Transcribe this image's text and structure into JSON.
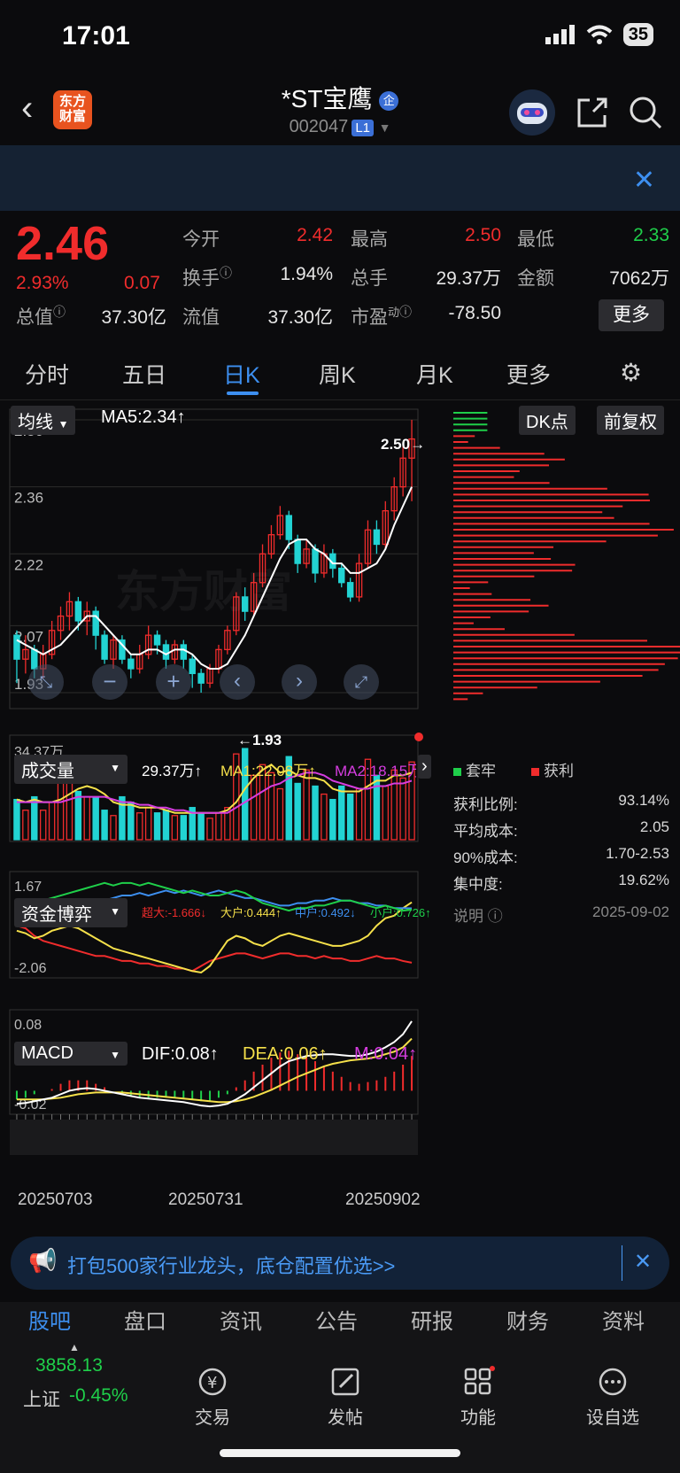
{
  "status": {
    "time": "17:01",
    "battery": "35"
  },
  "header": {
    "logo_line1": "东方",
    "logo_line2": "财富",
    "stock_name": "*ST宝鹰",
    "stock_badge": "企",
    "stock_code": "002047",
    "level": "L1"
  },
  "quote": {
    "price": "2.46",
    "change_pct": "2.93%",
    "change": "0.07",
    "open_label": "今开",
    "open": "2.42",
    "high_label": "最高",
    "high": "2.50",
    "low_label": "最低",
    "low": "2.33",
    "turnover_label": "换手",
    "turnover": "1.94%",
    "volume_label": "总手",
    "volume": "29.37万",
    "amount_label": "金额",
    "amount": "7062万",
    "mcap_label": "总值",
    "mcap": "37.30亿",
    "float_label": "流值",
    "float": "37.30亿",
    "pe_label": "市盈",
    "pe_sup": "动",
    "pe": "-78.50",
    "more": "更多"
  },
  "tabs": [
    "分时",
    "五日",
    "日K",
    "周K",
    "月K",
    "更多"
  ],
  "main_panel": {
    "indicator": "均线",
    "ma5": "MA5:2.34↑",
    "dk": "DK点",
    "adjust": "前复权",
    "watermark": "东方财富",
    "high_mark": "2.50→",
    "low_mark": "←1.93"
  },
  "volume_panel": {
    "label": "成交量",
    "vol": "29.37万↑",
    "ma1": "MA1:22.08万↑",
    "ma2": "MA2:18.15万"
  },
  "fund_panel": {
    "label": "资金博弈",
    "super": "超大:-1.666↓",
    "big": "大户:0.444↑",
    "mid": "中户:0.492↓",
    "small": "小户:0.726↑"
  },
  "macd_panel": {
    "label": "MACD",
    "dif": "DIF:0.08↑",
    "dea": "DEA:0.06↑",
    "m": "M:0.04↑"
  },
  "dates": [
    "20250703",
    "20250731",
    "20250902"
  ],
  "chip": {
    "legend_trap": "套牢",
    "legend_profit": "获利",
    "rows": [
      {
        "label": "获利比例:",
        "value": "93.14%"
      },
      {
        "label": "平均成本:",
        "value": "2.05"
      },
      {
        "label": "90%成本:",
        "value": "1.70-2.53"
      },
      {
        "label": "集中度:",
        "value": "19.62%"
      }
    ],
    "note_label": "说明",
    "note_date": "2025-09-02"
  },
  "ad": {
    "text": "打包500家行业龙头，底仓配置优选>>"
  },
  "subtabs": [
    "股吧",
    "盘口",
    "资讯",
    "公告",
    "研报",
    "财务",
    "资料"
  ],
  "bottom_nav": {
    "index_value": "3858.13",
    "index_name": "上证",
    "index_change": "-0.45%",
    "items": [
      "交易",
      "发帖",
      "功能",
      "设自选"
    ]
  },
  "colors": {
    "up": "#f02c2c",
    "down": "#22d3d3",
    "accent": "#3d8ff0",
    "ma5": "#ffffff",
    "ma1": "#f5e04a",
    "ma2": "#d63de0"
  },
  "chart_data": [
    {
      "type": "candlestick",
      "title": "日K",
      "ylim": [
        1.93,
        2.5
      ],
      "y_ticks": [
        2.5,
        2.36,
        2.22,
        2.07,
        1.93
      ],
      "x_labels": [
        "20250703",
        "20250731",
        "20250902"
      ],
      "candles": [
        [
          2.05,
          2.0,
          2.06,
          1.95
        ],
        [
          2.0,
          2.02,
          2.05,
          1.97
        ],
        [
          2.02,
          1.98,
          2.03,
          1.96
        ],
        [
          1.98,
          2.01,
          2.03,
          1.96
        ],
        [
          2.01,
          2.06,
          2.08,
          2.0
        ],
        [
          2.06,
          2.09,
          2.11,
          2.04
        ],
        [
          2.09,
          2.12,
          2.14,
          2.06
        ],
        [
          2.12,
          2.08,
          2.13,
          2.06
        ],
        [
          2.08,
          2.1,
          2.12,
          2.05
        ],
        [
          2.1,
          2.05,
          2.11,
          2.02
        ],
        [
          2.05,
          2.0,
          2.06,
          1.99
        ],
        [
          2.0,
          2.04,
          2.05,
          1.98
        ],
        [
          2.04,
          2.0,
          2.05,
          1.99
        ],
        [
          2.0,
          1.98,
          2.01,
          1.96
        ],
        [
          1.98,
          2.01,
          2.03,
          1.97
        ],
        [
          2.01,
          2.05,
          2.07,
          2.0
        ],
        [
          2.05,
          2.03,
          2.06,
          2.01
        ],
        [
          2.03,
          2.0,
          2.04,
          1.98
        ],
        [
          2.0,
          2.03,
          2.04,
          1.99
        ],
        [
          2.03,
          2.0,
          2.04,
          1.98
        ],
        [
          2.0,
          1.97,
          2.01,
          1.94
        ],
        [
          1.97,
          1.95,
          1.98,
          1.93
        ],
        [
          1.95,
          1.98,
          1.99,
          1.94
        ],
        [
          1.98,
          2.02,
          2.03,
          1.97
        ],
        [
          2.02,
          2.06,
          2.07,
          2.01
        ],
        [
          2.06,
          2.13,
          2.14,
          2.05
        ],
        [
          2.13,
          2.1,
          2.15,
          2.08
        ],
        [
          2.1,
          2.16,
          2.18,
          2.09
        ],
        [
          2.16,
          2.22,
          2.24,
          2.15
        ],
        [
          2.22,
          2.26,
          2.28,
          2.21
        ],
        [
          2.26,
          2.3,
          2.32,
          2.25
        ],
        [
          2.3,
          2.25,
          2.31,
          2.23
        ],
        [
          2.25,
          2.2,
          2.26,
          2.18
        ],
        [
          2.2,
          2.23,
          2.25,
          2.19
        ],
        [
          2.23,
          2.18,
          2.24,
          2.16
        ],
        [
          2.18,
          2.22,
          2.24,
          2.17
        ],
        [
          2.22,
          2.19,
          2.23,
          2.17
        ],
        [
          2.19,
          2.16,
          2.2,
          2.15
        ],
        [
          2.16,
          2.13,
          2.17,
          2.12
        ],
        [
          2.13,
          2.2,
          2.22,
          2.12
        ],
        [
          2.2,
          2.27,
          2.29,
          2.19
        ],
        [
          2.27,
          2.24,
          2.29,
          2.22
        ],
        [
          2.24,
          2.31,
          2.33,
          2.23
        ],
        [
          2.31,
          2.36,
          2.38,
          2.29
        ],
        [
          2.36,
          2.42,
          2.45,
          2.34
        ],
        [
          2.42,
          2.46,
          2.5,
          2.33
        ]
      ],
      "ma5": [
        2.04,
        2.03,
        2.02,
        2.01,
        2.02,
        2.03,
        2.05,
        2.07,
        2.09,
        2.09,
        2.07,
        2.05,
        2.03,
        2.01,
        2.01,
        2.02,
        2.02,
        2.01,
        2.02,
        2.02,
        2.01,
        1.99,
        1.98,
        1.98,
        1.99,
        2.02,
        2.05,
        2.09,
        2.13,
        2.17,
        2.21,
        2.24,
        2.25,
        2.25,
        2.23,
        2.22,
        2.2,
        2.2,
        2.18,
        2.18,
        2.19,
        2.2,
        2.23,
        2.28,
        2.32,
        2.36
      ]
    },
    {
      "type": "bar",
      "title": "成交量",
      "ylim": [
        0,
        34.37
      ],
      "y_ticks_label": "34.37万",
      "values": [
        15,
        11,
        16,
        11,
        14,
        26,
        30,
        18,
        16,
        16,
        11,
        9,
        16,
        14,
        10,
        12,
        10,
        11,
        9,
        9,
        12,
        10,
        8,
        10,
        12,
        32,
        34,
        24,
        28,
        25,
        19,
        31,
        21,
        26,
        20,
        17,
        15,
        20,
        17,
        19,
        30,
        24,
        20,
        26,
        23,
        29
      ],
      "ma1": [
        15,
        14,
        15,
        14,
        14,
        15,
        17,
        19,
        20,
        19,
        17,
        14,
        13,
        13,
        12,
        12,
        12,
        11,
        10,
        10,
        10,
        10,
        10,
        10,
        11,
        14,
        19,
        23,
        26,
        28,
        25,
        26,
        24,
        23,
        23,
        22,
        19,
        18,
        18,
        18,
        20,
        22,
        22,
        24,
        24,
        25
      ],
      "ma2": [
        14,
        14,
        14,
        14,
        14,
        14,
        15,
        16,
        16,
        16,
        16,
        15,
        14,
        14,
        13,
        13,
        12,
        12,
        11,
        11,
        10,
        10,
        10,
        10,
        10,
        12,
        14,
        16,
        18,
        20,
        21,
        23,
        24,
        25,
        25,
        24,
        22,
        21,
        20,
        19,
        19,
        20,
        20,
        21,
        21,
        22
      ]
    },
    {
      "type": "line",
      "title": "资金博弈",
      "ylim": [
        -2.06,
        1.67
      ],
      "series": [
        {
          "name": "超大",
          "values": [
            -0.2,
            -0.3,
            -0.6,
            -0.8,
            -0.9,
            -1.0,
            -1.1,
            -1.2,
            -1.3,
            -1.4,
            -1.4,
            -1.5,
            -1.6,
            -1.6,
            -1.7,
            -1.7,
            -1.8,
            -1.8,
            -1.9,
            -1.9,
            -2.0,
            -1.8,
            -1.6,
            -1.5,
            -1.4,
            -1.3,
            -1.3,
            -1.4,
            -1.5,
            -1.4,
            -1.3,
            -1.3,
            -1.4,
            -1.4,
            -1.5,
            -1.4,
            -1.5,
            -1.5,
            -1.6,
            -1.6,
            -1.5,
            -1.4,
            -1.5,
            -1.5,
            -1.6,
            -1.67
          ]
        },
        {
          "name": "大户",
          "values": [
            0.6,
            0.7,
            0.6,
            0.8,
            0.9,
            1.0,
            1.1,
            1.2,
            1.3,
            1.4,
            1.5,
            1.4,
            1.5,
            1.5,
            1.4,
            1.5,
            1.4,
            1.3,
            1.2,
            1.1,
            1.2,
            1.1,
            1.0,
            1.0,
            1.1,
            1.2,
            1.1,
            0.9,
            0.7,
            0.6,
            0.5,
            0.4,
            0.5,
            0.5,
            0.6,
            0.6,
            0.7,
            0.8,
            0.8,
            0.7,
            0.6,
            0.5,
            0.6,
            0.5,
            0.4,
            0.44
          ]
        },
        {
          "name": "中户",
          "values": [
            -0.1,
            0.0,
            0.1,
            0.2,
            0.3,
            0.3,
            0.4,
            0.5,
            0.6,
            0.7,
            0.8,
            0.9,
            1.0,
            1.0,
            1.1,
            1.0,
            1.1,
            1.2,
            1.1,
            1.2,
            1.1,
            1.0,
            1.1,
            1.2,
            1.1,
            1.0,
            0.9,
            0.9,
            0.8,
            0.7,
            0.6,
            0.6,
            0.7,
            0.7,
            0.8,
            0.8,
            0.9,
            0.8,
            0.8,
            0.7,
            0.7,
            0.6,
            0.6,
            0.5,
            0.5,
            0.49
          ]
        },
        {
          "name": "小户",
          "values": [
            -0.4,
            -0.5,
            -0.7,
            -0.6,
            -0.4,
            -0.3,
            -0.2,
            -0.3,
            -0.5,
            -0.7,
            -0.9,
            -1.1,
            -1.2,
            -1.3,
            -1.4,
            -1.5,
            -1.6,
            -1.7,
            -1.8,
            -1.9,
            -2.0,
            -2.06,
            -1.8,
            -1.3,
            -0.8,
            -0.6,
            -0.7,
            -0.9,
            -1.0,
            -0.8,
            -0.6,
            -0.5,
            -0.6,
            -0.7,
            -0.8,
            -0.9,
            -1.0,
            -1.0,
            -0.9,
            -0.8,
            -0.6,
            -0.2,
            0.1,
            0.2,
            0.5,
            0.73
          ]
        }
      ]
    },
    {
      "type": "line",
      "title": "MACD",
      "ylim": [
        -0.02,
        0.08
      ],
      "dif": [
        -0.015,
        -0.014,
        -0.012,
        -0.01,
        -0.008,
        -0.004,
        0.0,
        0.002,
        0.003,
        0.002,
        0.0,
        -0.002,
        -0.004,
        -0.006,
        -0.008,
        -0.009,
        -0.01,
        -0.011,
        -0.012,
        -0.013,
        -0.015,
        -0.017,
        -0.018,
        -0.017,
        -0.015,
        -0.01,
        -0.004,
        0.004,
        0.012,
        0.02,
        0.028,
        0.034,
        0.037,
        0.04,
        0.041,
        0.042,
        0.042,
        0.041,
        0.04,
        0.04,
        0.042,
        0.045,
        0.05,
        0.056,
        0.065,
        0.08
      ],
      "dea": [
        -0.01,
        -0.01,
        -0.01,
        -0.01,
        -0.009,
        -0.008,
        -0.006,
        -0.004,
        -0.003,
        -0.002,
        -0.002,
        -0.002,
        -0.002,
        -0.003,
        -0.004,
        -0.005,
        -0.006,
        -0.007,
        -0.008,
        -0.009,
        -0.01,
        -0.011,
        -0.012,
        -0.013,
        -0.013,
        -0.012,
        -0.01,
        -0.007,
        -0.003,
        0.001,
        0.006,
        0.011,
        0.016,
        0.02,
        0.024,
        0.028,
        0.031,
        0.033,
        0.035,
        0.036,
        0.037,
        0.039,
        0.042,
        0.045,
        0.05,
        0.06
      ],
      "m": [
        -0.005,
        -0.004,
        -0.002,
        0.0,
        0.001,
        0.004,
        0.006,
        0.006,
        0.006,
        0.004,
        0.002,
        0.0,
        -0.002,
        -0.003,
        -0.004,
        -0.004,
        -0.004,
        -0.004,
        -0.004,
        -0.004,
        -0.005,
        -0.006,
        -0.006,
        -0.004,
        -0.002,
        0.002,
        0.006,
        0.011,
        0.015,
        0.019,
        0.022,
        0.023,
        0.021,
        0.02,
        0.017,
        0.014,
        0.011,
        0.008,
        0.005,
        0.004,
        0.005,
        0.006,
        0.008,
        0.011,
        0.015,
        0.02
      ]
    }
  ]
}
